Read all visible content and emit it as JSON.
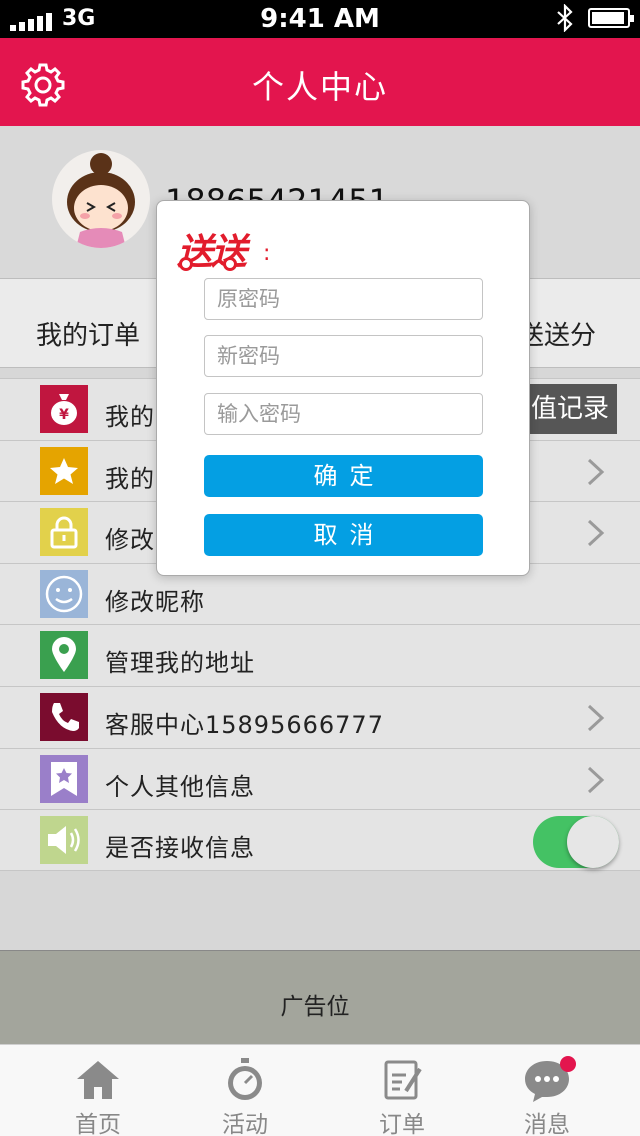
{
  "status_bar": {
    "carrier": "3G",
    "time": "9:41 AM"
  },
  "header": {
    "title": "个人中心",
    "settings_icon": "gear-icon"
  },
  "profile": {
    "phone": "18865421451"
  },
  "tabs": {
    "left": "我的订单",
    "right": "送送分"
  },
  "recharge_label": "值记录",
  "menu": [
    {
      "label": "我的",
      "icon": "money-bag-icon",
      "color": "#c0163f",
      "chevron": false
    },
    {
      "label": "我的",
      "icon": "star-icon",
      "color": "#e5a400",
      "chevron": true
    },
    {
      "label": "修改",
      "icon": "lock-icon",
      "color": "#e2d14b",
      "chevron": true
    },
    {
      "label": "修改昵称",
      "icon": "smiley-icon",
      "color": "#9ab5d8",
      "chevron": false
    },
    {
      "label": "管理我的地址",
      "icon": "location-pin-icon",
      "color": "#3aa04f",
      "chevron": false
    },
    {
      "label": "客服中心15895666777",
      "icon": "phone-icon",
      "color": "#7a0c2e",
      "chevron": true
    },
    {
      "label": "个人其他信息",
      "icon": "bookmark-star-icon",
      "color": "#9a7fc9",
      "chevron": true
    },
    {
      "label": "是否接收信息",
      "icon": "speaker-icon",
      "color": "#bfd68e",
      "toggle": true,
      "toggle_on": true
    }
  ],
  "ad": {
    "label": "广告位"
  },
  "tabbar": [
    {
      "label": "首页",
      "icon": "home-icon"
    },
    {
      "label": "活动",
      "icon": "timer-icon"
    },
    {
      "label": "订单",
      "icon": "edit-note-icon"
    },
    {
      "label": "消息",
      "icon": "chat-bubble-icon",
      "badge": true
    }
  ],
  "modal": {
    "logo_text": "送送",
    "logo_colon": ":",
    "old_password_placeholder": "原密码",
    "new_password_placeholder": "新密码",
    "confirm_password_placeholder": "输入密码",
    "confirm_button": "确定",
    "cancel_button": "取消",
    "button_color": "#049fe3"
  },
  "colors": {
    "brand": "#e3154e",
    "toggle_on": "#44c264"
  }
}
